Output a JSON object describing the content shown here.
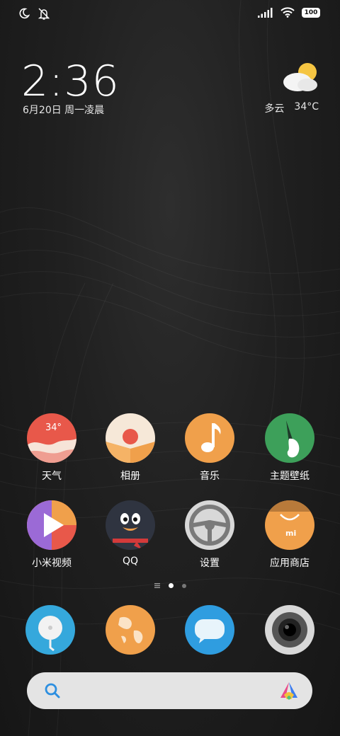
{
  "status_bar": {
    "icons": [
      "moon-icon",
      "mute-icon",
      "signal-icon",
      "wifi-icon",
      "battery-icon"
    ],
    "battery_level": "100"
  },
  "clock_widget": {
    "time": "2:36",
    "date": "6月20日 周一凌晨"
  },
  "weather_widget": {
    "condition": "多云",
    "temperature": "34°C",
    "icon": "partly-cloudy-icon"
  },
  "apps": [
    {
      "label": "天气",
      "icon": "weather-app-icon",
      "badge_text": "34°"
    },
    {
      "label": "相册",
      "icon": "gallery-app-icon"
    },
    {
      "label": "音乐",
      "icon": "music-app-icon"
    },
    {
      "label": "主题壁纸",
      "icon": "themes-app-icon"
    },
    {
      "label": "小米视频",
      "icon": "video-app-icon"
    },
    {
      "label": "QQ",
      "icon": "qq-app-icon"
    },
    {
      "label": "设置",
      "icon": "settings-app-icon"
    },
    {
      "label": "应用商店",
      "icon": "app-store-icon",
      "badge_text": "mi"
    }
  ],
  "page_indicator": {
    "pages": 2,
    "current": 1
  },
  "dock": [
    {
      "icon": "phone-app-icon"
    },
    {
      "icon": "browser-app-icon"
    },
    {
      "icon": "messages-app-icon"
    },
    {
      "icon": "camera-app-icon"
    }
  ],
  "search_bar": {
    "placeholder": "",
    "icon": "search-icon",
    "assistant_icon": "xiaoai-logo-icon"
  },
  "colors": {
    "search_icon": "#2d8fe0",
    "background": "#1e1e1e"
  }
}
